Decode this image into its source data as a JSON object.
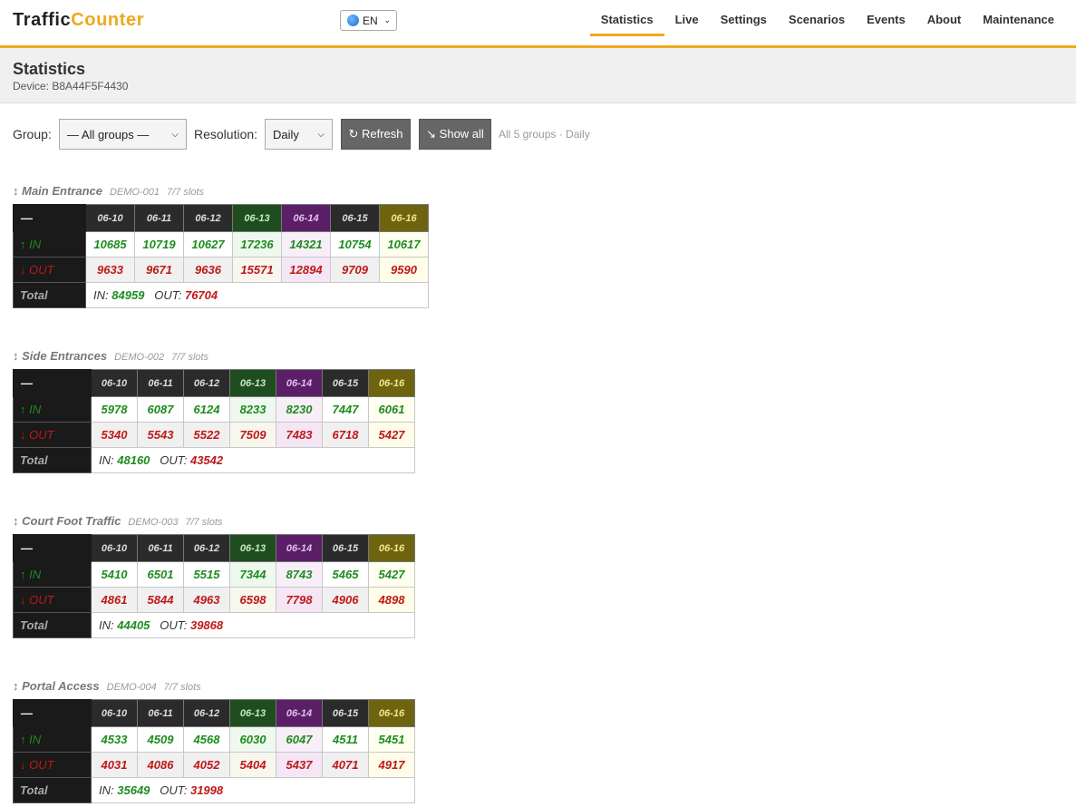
{
  "brand": {
    "part1": "Traffic",
    "part2": "Counter"
  },
  "lang": {
    "value": "EN"
  },
  "nav": [
    "Statistics",
    "Live",
    "Settings",
    "Scenarios",
    "Events",
    "About",
    "Maintenance"
  ],
  "page": {
    "title": "Statistics",
    "device": "Device: B8A44F5F4430"
  },
  "controls": {
    "group_label": "Group:",
    "group_value": "— All groups —",
    "resolution_label": "Resolution:",
    "resolution_value": "Daily",
    "refresh_label": "↻ Refresh",
    "showall_label": "↘ Show all",
    "summary": "All 5 groups · Daily"
  },
  "table_labels": {
    "corner": "—",
    "in": "↑ IN",
    "out": "↓ OUT",
    "total": "Total",
    "in_total": "IN:",
    "out_total": "OUT:"
  },
  "dates": [
    "06-10",
    "06-11",
    "06-12",
    "06-13",
    "06-14",
    "06-15",
    "06-16"
  ],
  "date_colors": [
    "#2b2b2b",
    "#2b2b2b",
    "#2b2b2b",
    "#1f4d1f",
    "#5a1f66",
    "#2b2b2b",
    "#6e6410"
  ],
  "cell_bg": {
    "in": [
      "#ffffff",
      "#ffffff",
      "#ffffff",
      "#eef8ee",
      "#f7eef8",
      "#ffffff",
      "#fffff0"
    ],
    "out": [
      "#f0f0f0",
      "#f0f0f0",
      "#f0f0f0",
      "#f7f7ee",
      "#f4e6f5",
      "#f0f0f0",
      "#fdfdea"
    ]
  },
  "groups": [
    {
      "name": "Main Entrance",
      "id": "DEMO-001",
      "slots": "7/7 slots",
      "in": [
        "10685",
        "10719",
        "10627",
        "17236",
        "14321",
        "10754",
        "10617"
      ],
      "out": [
        "9633",
        "9671",
        "9636",
        "15571",
        "12894",
        "9709",
        "9590"
      ],
      "total_in": "84959",
      "total_out": "76704"
    },
    {
      "name": "Side Entrances",
      "id": "DEMO-002",
      "slots": "7/7 slots",
      "in": [
        "5978",
        "6087",
        "6124",
        "8233",
        "8230",
        "7447",
        "6061"
      ],
      "out": [
        "5340",
        "5543",
        "5522",
        "7509",
        "7483",
        "6718",
        "5427"
      ],
      "total_in": "48160",
      "total_out": "43542"
    },
    {
      "name": "Court Foot Traffic",
      "id": "DEMO-003",
      "slots": "7/7 slots",
      "in": [
        "5410",
        "6501",
        "5515",
        "7344",
        "8743",
        "5465",
        "5427"
      ],
      "out": [
        "4861",
        "5844",
        "4963",
        "6598",
        "7798",
        "4906",
        "4898"
      ],
      "total_in": "44405",
      "total_out": "39868"
    },
    {
      "name": "Portal Access",
      "id": "DEMO-004",
      "slots": "7/7 slots",
      "in": [
        "4533",
        "4509",
        "4568",
        "6030",
        "6047",
        "4511",
        "5451"
      ],
      "out": [
        "4031",
        "4086",
        "4052",
        "5404",
        "5437",
        "4071",
        "4917"
      ],
      "total_in": "35649",
      "total_out": "31998"
    }
  ]
}
